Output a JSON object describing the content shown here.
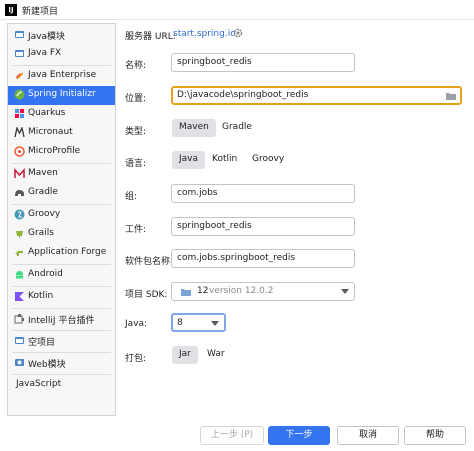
{
  "window": {
    "app_icon": "IJ",
    "title": "新建项目"
  },
  "sidebar": {
    "items": [
      {
        "label": "Java模块",
        "icon": "module-icon"
      },
      {
        "label": "Java FX",
        "icon": "module-icon"
      },
      {
        "label": "Java Enterprise",
        "icon": "java-enterprise-icon"
      },
      {
        "label": "Spring Initializr",
        "icon": "spring-icon"
      },
      {
        "label": "Quarkus",
        "icon": "quarkus-icon"
      },
      {
        "label": "Micronaut",
        "icon": "micronaut-icon"
      },
      {
        "label": "MicroProfile",
        "icon": "microprofile-icon"
      },
      {
        "label": "Maven",
        "icon": "maven-icon"
      },
      {
        "label": "Gradle",
        "icon": "gradle-icon"
      },
      {
        "label": "Groovy",
        "icon": "groovy-icon"
      },
      {
        "label": "Grails",
        "icon": "grails-icon"
      },
      {
        "label": "Application Forge",
        "icon": "application-forge-icon"
      },
      {
        "label": "Android",
        "icon": "android-icon"
      },
      {
        "label": "Kotlin",
        "icon": "kotlin-icon"
      },
      {
        "label": "IntelliJ 平台插件",
        "icon": "plugin-icon"
      },
      {
        "label": "空项目",
        "icon": "module-icon"
      },
      {
        "label": "Web模块",
        "icon": "web-icon"
      },
      {
        "label": "JavaScript",
        "icon": ""
      }
    ],
    "selected": "Spring Initializr"
  },
  "form": {
    "server_url_label": "服务器 URL:",
    "server_url_value": "start.spring.io",
    "name_label": "名称:",
    "name_value": "springboot_redis",
    "location_label": "位置:",
    "location_value": "D:\\javacode\\springboot_redis",
    "type_label": "类型:",
    "type_options": [
      "Maven",
      "Gradle"
    ],
    "type_selected": "Maven",
    "language_label": "语言:",
    "language_options": [
      "Java",
      "Kotlin",
      "Groovy"
    ],
    "language_selected": "Java",
    "group_label": "组:",
    "group_value": "com.jobs",
    "artifact_label": "工件:",
    "artifact_value": "springboot_redis",
    "package_label": "软件包名称:",
    "package_value": "com.jobs.springboot_redis",
    "sdk_label": "项目 SDK:",
    "sdk_value": "12",
    "sdk_version": "version 12.0.2",
    "java_label": "Java:",
    "java_value": "8",
    "packaging_label": "打包:",
    "packaging_options": [
      "Jar",
      "War"
    ],
    "packaging_selected": "Jar"
  },
  "buttons": {
    "previous": "上一步 (P)",
    "next": "下一步",
    "cancel": "取消",
    "help": "帮助"
  },
  "colors": {
    "accent": "#3574f0",
    "focus": "#e6a21b",
    "link": "#2f6ad8"
  }
}
